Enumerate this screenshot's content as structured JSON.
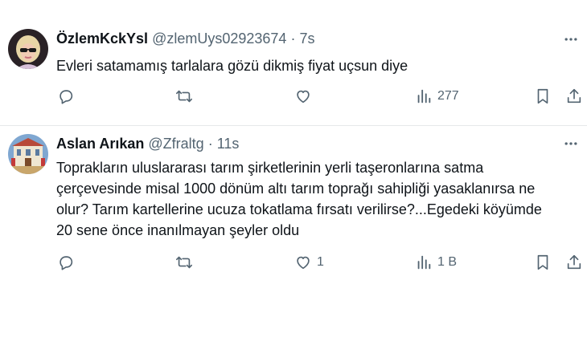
{
  "tweets": [
    {
      "display_name": "ÖzlemKckYsl",
      "handle": "@zlemUys02923674",
      "separator": "·",
      "time": "7s",
      "text_lines": [
        "Evleri satamamış tarlalara gözü dikmiş fiyat uçsun diye"
      ],
      "actions": {
        "reply_count": "",
        "repost_count": "",
        "like_count": "",
        "views_count": "277"
      },
      "avatar_icon": "profile-photo-blonde-woman-sunglasses"
    },
    {
      "display_name": "Aslan Arıkan",
      "handle": "@Zfraltg",
      "separator": "·",
      "time": "11s",
      "text_lines": [
        "Toprakların uluslararası tarım şirketlerinin yerli taşeronlarına satma",
        "çerçevesinde misal 1000 dönüm altı tarım toprağı sahipliği yasaklanırsa ne",
        "olur? Tarım kartellerine ucuza tokatlama fırsatı verilirse?...Egedeki köyümde",
        "20 sene önce inanılmayan şeyler oldu"
      ],
      "actions": {
        "reply_count": "",
        "repost_count": "",
        "like_count": "1",
        "views_count": "1 B"
      },
      "avatar_icon": "profile-photo-building-facade"
    }
  ],
  "icons": {
    "more": "more-horizontal-icon",
    "reply": "reply-icon",
    "repost": "repost-icon",
    "like": "heart-icon",
    "views": "views-bar-chart-icon",
    "bookmark": "bookmark-icon",
    "share": "share-icon"
  },
  "colors": {
    "text_primary": "#0f1419",
    "text_secondary": "#536471",
    "divider": "#e6e9ea"
  }
}
